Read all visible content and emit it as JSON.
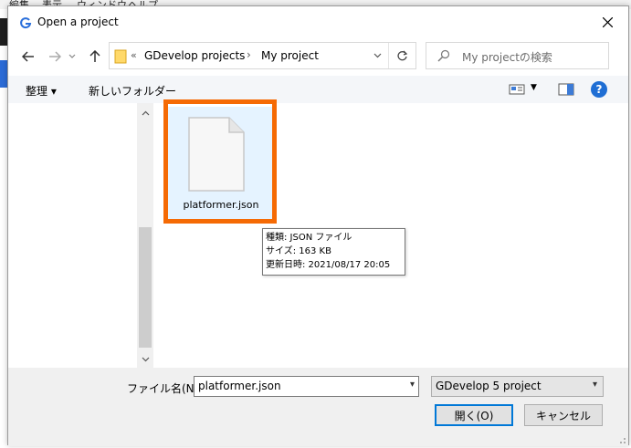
{
  "background_app": {
    "menu": [
      "編集",
      "表示",
      "ウィンドウ",
      "ヘルプ"
    ]
  },
  "dialog": {
    "title": "Open a project",
    "close_icon": "close-icon"
  },
  "address": {
    "chevron": "«",
    "crumbs": [
      "GDevelop projects",
      "My project"
    ],
    "separator": "›"
  },
  "search": {
    "placeholder": "My projectの検索"
  },
  "toolbar": {
    "organize_label": "整理 ▾",
    "new_folder_label": "新しいフォルダー",
    "help_label": "?"
  },
  "files": [
    {
      "name": "platformer.json",
      "selected": true
    }
  ],
  "tooltip": {
    "type_line": "種類: JSON ファイル",
    "size_line": "サイズ: 163 KB",
    "date_line": "更新日時: 2021/08/17 20:05"
  },
  "bottom": {
    "filename_label": "ファイル名(N):",
    "filename_value": "platformer.json",
    "filetype_value": "GDevelop 5 project",
    "open_label": "開く(O)",
    "cancel_label": "キャンセル"
  },
  "colors": {
    "highlight": "#f56a04",
    "selection": "#e5f3ff",
    "accent": "#0078d7"
  }
}
